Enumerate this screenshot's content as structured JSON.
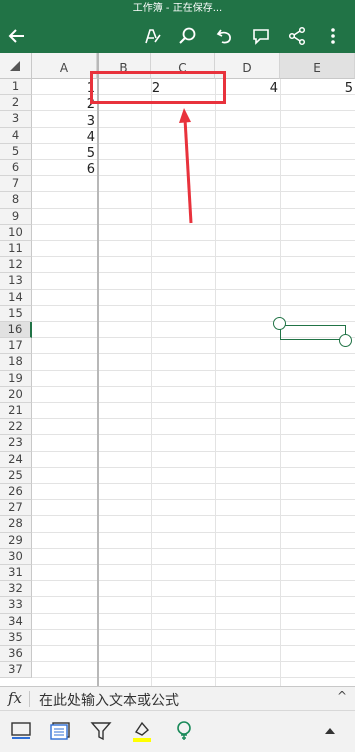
{
  "status": {
    "title": "工作簿 - 正在保存..."
  },
  "toolbar": {
    "back": "back-arrow-icon",
    "icons": [
      "pen-draw-icon",
      "search-icon",
      "undo-icon",
      "comment-icon",
      "share-icon",
      "more-vertical-icon"
    ]
  },
  "sheet": {
    "columns": [
      "A",
      "B",
      "C",
      "D",
      "E"
    ],
    "selected_column": "E",
    "rows": [
      "1",
      "2",
      "3",
      "4",
      "5",
      "6",
      "7",
      "8",
      "9",
      "10",
      "11",
      "12",
      "13",
      "14",
      "15",
      "16",
      "17",
      "18",
      "19",
      "20",
      "21",
      "22",
      "23",
      "24",
      "25",
      "26",
      "27",
      "28",
      "29",
      "30",
      "31",
      "32",
      "33",
      "34",
      "35",
      "36",
      "37"
    ],
    "selected_row": "16",
    "cells": {
      "A1": "1",
      "A2": "2",
      "A3": "3",
      "A4": "4",
      "A5": "5",
      "A6": "6",
      "B1_C1": "2",
      "D1": "4",
      "E1": "5"
    }
  },
  "formula_bar": {
    "fx": "fx",
    "placeholder": "在此处输入文本或公式",
    "expand": "^"
  },
  "bottom_bar": {
    "icons": [
      "sheet-view-icon",
      "card-view-icon",
      "filter-icon",
      "fill-color-icon",
      "idea-bulb-icon",
      "expand-up-icon"
    ],
    "accent": "#ffff00"
  },
  "colors": {
    "brand": "#217346",
    "annotation": "#e8323c"
  }
}
